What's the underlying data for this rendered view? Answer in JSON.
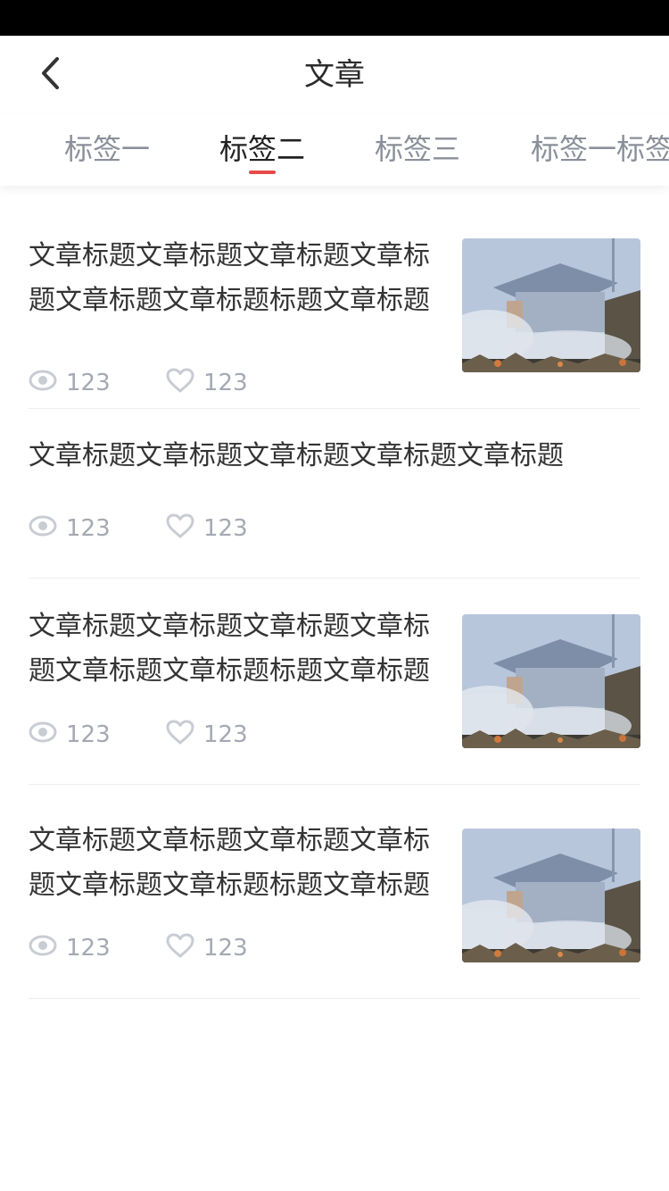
{
  "header": {
    "title": "文章",
    "back_icon": "chevron-left-icon"
  },
  "tabs": [
    {
      "label": "标签一",
      "active": false
    },
    {
      "label": "标签二",
      "active": true
    },
    {
      "label": "标签三",
      "active": false
    },
    {
      "label": "标签一标签",
      "active": false
    }
  ],
  "colors": {
    "accent": "#e64a4a",
    "text_primary": "#333333",
    "text_secondary": "#a4a9b2"
  },
  "articles": [
    {
      "title": "文章标题文章标题文章标题文章标题文章标题文章标题标题文章标题",
      "views": "123",
      "likes": "123",
      "has_thumbnail": true
    },
    {
      "title": "文章标题文章标题文章标题文章标题文章标题",
      "views": "123",
      "likes": "123",
      "has_thumbnail": false
    },
    {
      "title": "文章标题文章标题文章标题文章标题文章标题文章标题标题文章标题",
      "views": "123",
      "likes": "123",
      "has_thumbnail": true
    },
    {
      "title": "文章标题文章标题文章标题文章标题文章标题文章标题标题文章标题",
      "views": "123",
      "likes": "123",
      "has_thumbnail": true
    }
  ]
}
